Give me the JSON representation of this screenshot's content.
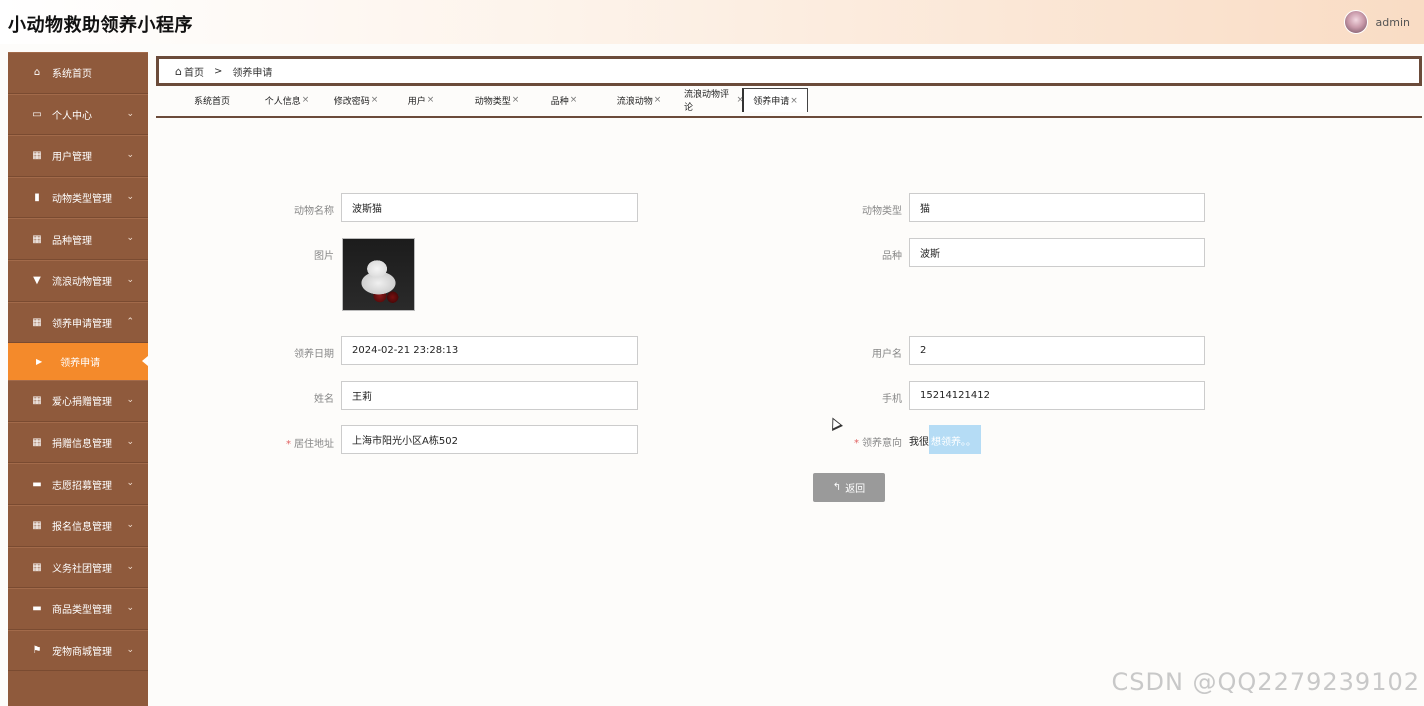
{
  "header": {
    "title": "小动物救助领养小程序",
    "user_name": "admin"
  },
  "sidebar": {
    "items": [
      {
        "label": "系统首页",
        "icon": "home-icon",
        "glyph": "⌂",
        "chevron": ""
      },
      {
        "label": "个人中心",
        "icon": "window-icon",
        "glyph": "▭",
        "chevron": "⌄"
      },
      {
        "label": "用户管理",
        "icon": "grid-icon",
        "glyph": "▦",
        "chevron": "⌄"
      },
      {
        "label": "动物类型管理",
        "icon": "bar-chart-icon",
        "glyph": "▮",
        "chevron": "⌄"
      },
      {
        "label": "品种管理",
        "icon": "grid-icon",
        "glyph": "▦",
        "chevron": "⌄"
      },
      {
        "label": "流浪动物管理",
        "icon": "cup-icon",
        "glyph": "▼",
        "chevron": "⌄"
      },
      {
        "label": "领养申请管理",
        "icon": "grid-icon",
        "glyph": "▦",
        "chevron": "⌃"
      }
    ],
    "active_sub": {
      "label": "领养申请",
      "icon": "play-icon",
      "glyph": "▶"
    },
    "items_after": [
      {
        "label": "爱心捐赠管理",
        "icon": "grid-icon",
        "glyph": "▦",
        "chevron": "⌄"
      },
      {
        "label": "捐赠信息管理",
        "icon": "calendar-icon",
        "glyph": "▦",
        "chevron": "⌄"
      },
      {
        "label": "志愿招募管理",
        "icon": "monitor-icon",
        "glyph": "▬",
        "chevron": "⌄"
      },
      {
        "label": "报名信息管理",
        "icon": "grid-icon",
        "glyph": "▦",
        "chevron": "⌄"
      },
      {
        "label": "义务社团管理",
        "icon": "grid-icon",
        "glyph": "▦",
        "chevron": "⌄"
      },
      {
        "label": "商品类型管理",
        "icon": "monitor-icon",
        "glyph": "▬",
        "chevron": "⌄"
      },
      {
        "label": "宠物商城管理",
        "icon": "flag-icon",
        "glyph": "⚑",
        "chevron": "⌄"
      }
    ]
  },
  "breadcrumb": {
    "home": "首页",
    "separator": ">",
    "current": "领养申请"
  },
  "tabs": [
    {
      "label": "系统首页",
      "close": ""
    },
    {
      "label": "个人信息",
      "close": "×"
    },
    {
      "label": "修改密码",
      "close": "×"
    },
    {
      "label": "用户",
      "close": "×"
    },
    {
      "label": "动物类型",
      "close": "×"
    },
    {
      "label": "品种",
      "close": "×"
    },
    {
      "label": "流浪动物",
      "close": "×"
    },
    {
      "label": "流浪动物评论",
      "close": "×"
    },
    {
      "label": "领养申请",
      "close": "×"
    }
  ],
  "form": {
    "animal_name_label": "动物名称",
    "animal_name": "波斯猫",
    "animal_type_label": "动物类型",
    "animal_type": "猫",
    "image_label": "图片",
    "breed_label": "品种",
    "breed": "波斯",
    "adopt_date_label": "领养日期",
    "adopt_date": "2024-02-21 23:28:13",
    "username_label": "用户名",
    "username": "2",
    "name_label": "姓名",
    "name": "王莉",
    "phone_label": "手机",
    "phone": "15214121412",
    "address_required": "*",
    "address_label": "居住地址",
    "address": "上海市阳光小区A栋502",
    "intent_required": "*",
    "intent_label": "领养意向",
    "intent_plain": "我很",
    "intent_highlight": "想领养。。",
    "back_icon": "↰",
    "back_label": "返回"
  },
  "watermark": "CSDN @QQ2279239102"
}
